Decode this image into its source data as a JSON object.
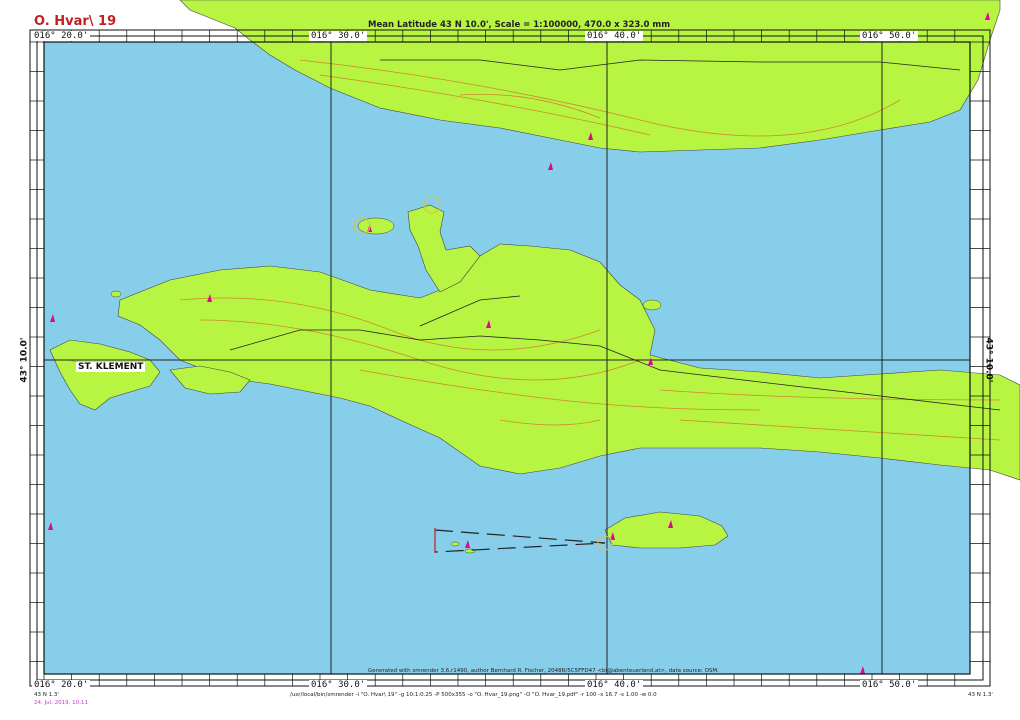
{
  "chart": {
    "name": "O. Hvar\\ 19",
    "meta": "Mean Latitude 43 N 10.0', Scale = 1:100000, 470.0 x 323.0 mm"
  },
  "longitude_labels_top": [
    "016° 20.0'",
    "016° 30.0'",
    "016° 40.0'",
    "016° 50.0'"
  ],
  "longitude_labels_bottom": [
    "016° 20.0'",
    "016° 30.0'",
    "016° 40.0'",
    "016° 50.0'"
  ],
  "latitude_labels": [
    "43° 10.0'",
    "43° 10.0'"
  ],
  "places": {
    "st_klement": "ST. KLEMENT"
  },
  "footer": {
    "generated": "Generated with smrender 3.6.r1490, author Bernhard R. Fischer, 2048R/5C5FFD47 <bf@abenteuerland.at>, data source: OSM.",
    "command": "/usr/local/bin/smrender -i \"O. Hvar\\ 19\" -g 10:1:0.25 -P 500x355 -o \"O. Hvar_19.png\" -O \"O. Hvar_19.pdf\" -r 100 -x 16.7 -s 1.00 -w 0.0",
    "date": "24. Jul. 2019, 10:11",
    "corner_left": "43 N 1.3'",
    "corner_right": "43 N 1.3'"
  },
  "colors": {
    "sea": "#87ceeb",
    "land": "#b7f542",
    "contour": "#d4762a",
    "frame": "#111111",
    "grid": "#222222",
    "light_marker": "#e6009a"
  }
}
